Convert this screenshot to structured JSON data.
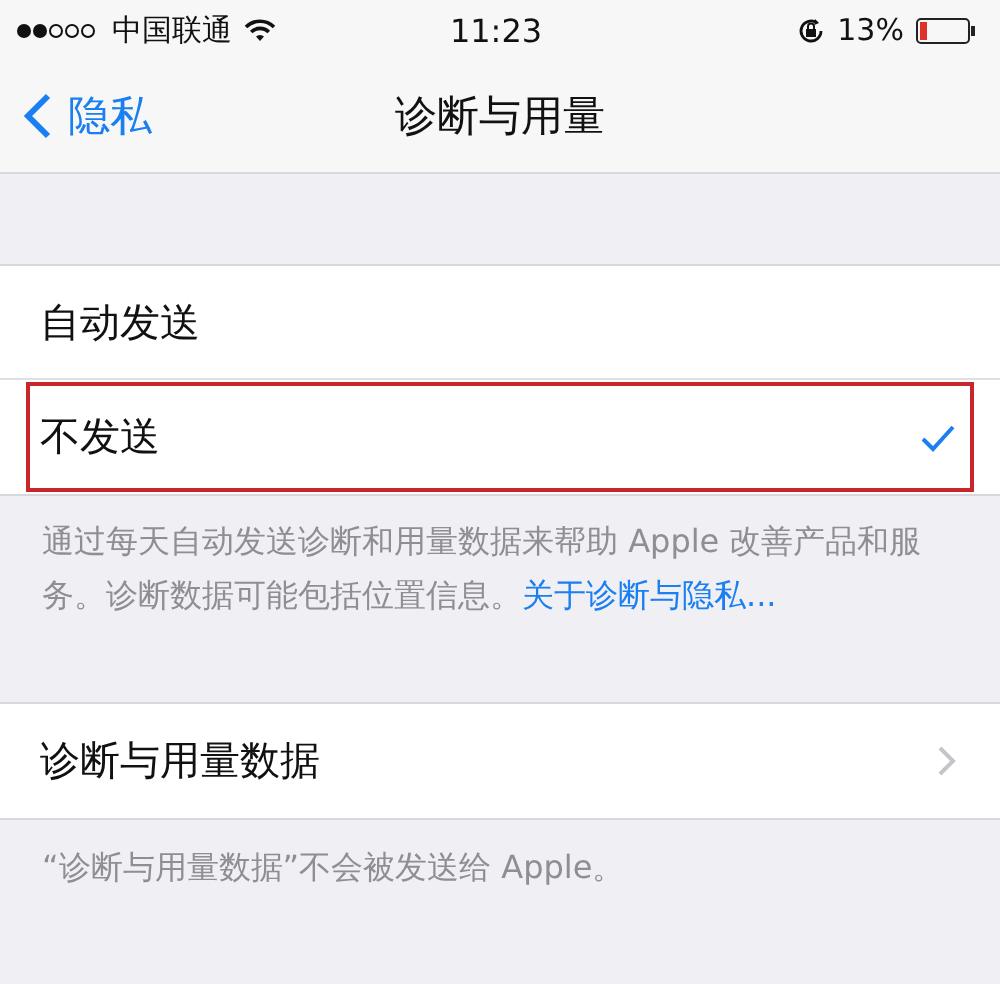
{
  "status_bar": {
    "carrier": "中国联通",
    "time": "11:23",
    "battery": "13%"
  },
  "nav": {
    "back": "隐私",
    "title": "诊断与用量"
  },
  "options": [
    {
      "label": "自动发送",
      "selected": false,
      "highlighted": false
    },
    {
      "label": "不发送",
      "selected": true,
      "highlighted": true
    }
  ],
  "options_footer": {
    "text": "通过每天自动发送诊断和用量数据来帮助 Apple 改善产品和服务。诊断数据可能包括位置信息。",
    "link": "关于诊断与隐私..."
  },
  "data_row": {
    "label": "诊断与用量数据"
  },
  "data_footer": "“诊断与用量数据”不会被发送给 Apple。"
}
